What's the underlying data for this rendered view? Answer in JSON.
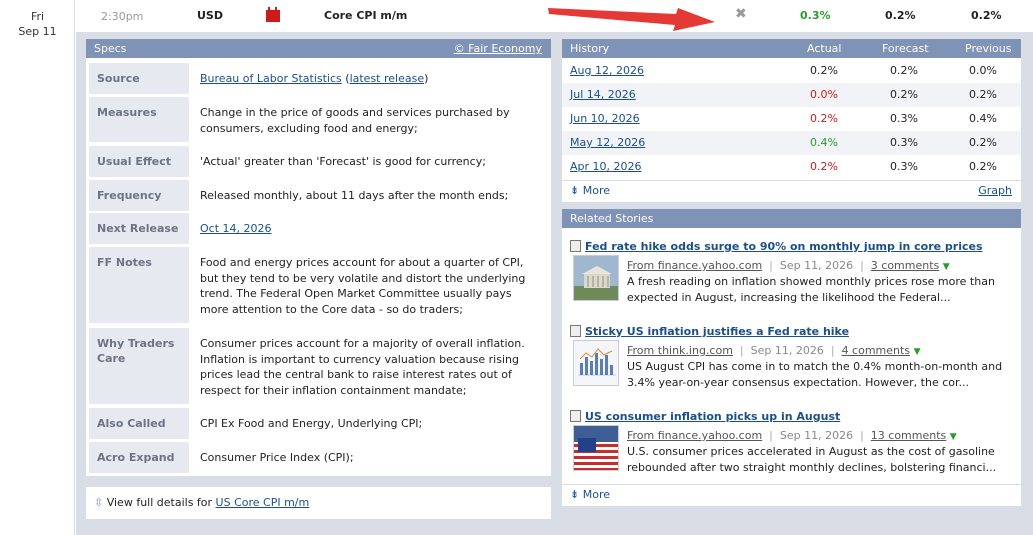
{
  "event": {
    "day_of_week": "Fri",
    "month_day": "Sep 11",
    "time": "2:30pm",
    "currency": "USD",
    "name": "Core CPI m/m",
    "actual": "0.3%",
    "forecast": "0.2%",
    "previous": "0.2%",
    "impact_icon": "red-high-impact-icon",
    "close_icon": "close-icon",
    "actual_color": "#2a9d2a"
  },
  "specs": {
    "title": "Specs",
    "source_link": "© Fair Economy",
    "rows": [
      {
        "label": "Source",
        "value_link": "Bureau of Labor Statistics",
        "value_open": " (",
        "value_link2": "latest release",
        "value_close": ")"
      },
      {
        "label": "Measures",
        "value": "Change in the price of goods and services purchased by consumers, excluding food and energy;"
      },
      {
        "label": "Usual Effect",
        "value": "'Actual' greater than 'Forecast' is good for currency;"
      },
      {
        "label": "Frequency",
        "value": "Released monthly, about 11 days after the month ends;"
      },
      {
        "label": "Next Release",
        "value_link": "Oct 14, 2026"
      },
      {
        "label": "FF Notes",
        "value": "Food and energy prices account for about a quarter of CPI, but they tend to be very volatile and distort the underlying trend. The Federal Open Market Committee usually pays more attention to the Core data - so do traders;"
      },
      {
        "label": "Why Traders Care",
        "value": "Consumer prices account for a majority of overall inflation. Inflation is important to currency valuation because rising prices lead the central bank to raise interest rates out of respect for their inflation containment mandate;"
      },
      {
        "label": "Also Called",
        "value": "CPI Ex Food and Energy, Underlying CPI;"
      },
      {
        "label": "Acro Expand",
        "value": "Consumer Price Index (CPI);"
      }
    ],
    "full_details_prefix": "View full details for",
    "full_details_link": "US Core CPI m/m",
    "full_details_icon": "expand-arrows-icon"
  },
  "history": {
    "title": "History",
    "col_actual": "Actual",
    "col_forecast": "Forecast",
    "col_previous": "Previous",
    "rows": [
      {
        "date": "Aug 12, 2026",
        "actual": "0.2%",
        "actual_color": "#222222",
        "forecast": "0.2%",
        "previous": "0.0%"
      },
      {
        "date": "Jul 14, 2026",
        "actual": "0.0%",
        "actual_color": "#cc1b1b",
        "forecast": "0.2%",
        "previous": "0.2%"
      },
      {
        "date": "Jun 10, 2026",
        "actual": "0.2%",
        "actual_color": "#cc1b1b",
        "forecast": "0.3%",
        "previous": "0.4%"
      },
      {
        "date": "May 12, 2026",
        "actual": "0.4%",
        "actual_color": "#2a9d2a",
        "forecast": "0.3%",
        "previous": "0.2%"
      },
      {
        "date": "Apr 10, 2026",
        "actual": "0.2%",
        "actual_color": "#cc1b1b",
        "forecast": "0.3%",
        "previous": "0.2%"
      }
    ],
    "more_label": "More",
    "graph_label": "Graph"
  },
  "related": {
    "title": "Related Stories",
    "stories": [
      {
        "title": "Fed rate hike odds surge to 90% on monthly jump in core prices",
        "source": "From finance.yahoo.com",
        "date": "Sep 11, 2026",
        "comments": "3 comments",
        "desc": "A fresh reading on inflation showed monthly prices rose more than expected in August, increasing the likelihood the Federal...",
        "thumb": "federal-reserve-building-thumbnail"
      },
      {
        "title": "Sticky US inflation justifies a Fed rate hike",
        "source": "From think.ing.com",
        "date": "Sep 11, 2026",
        "comments": "4 comments",
        "desc": "US August CPI has come in to match the 0.4% month-on-month and 3.4% year-on-year consensus expectation. However, the cor...",
        "thumb": "bar-chart-thumbnail"
      },
      {
        "title": "US consumer inflation picks up in August",
        "source": "From finance.yahoo.com",
        "date": "Sep 11, 2026",
        "comments": "13 comments",
        "desc": "U.S. consumer prices accelerated in August as the cost of gasoline rebounded after two straight monthly declines, bolstering financi...",
        "thumb": "us-flag-thumbnail"
      }
    ],
    "more_label": "More"
  }
}
